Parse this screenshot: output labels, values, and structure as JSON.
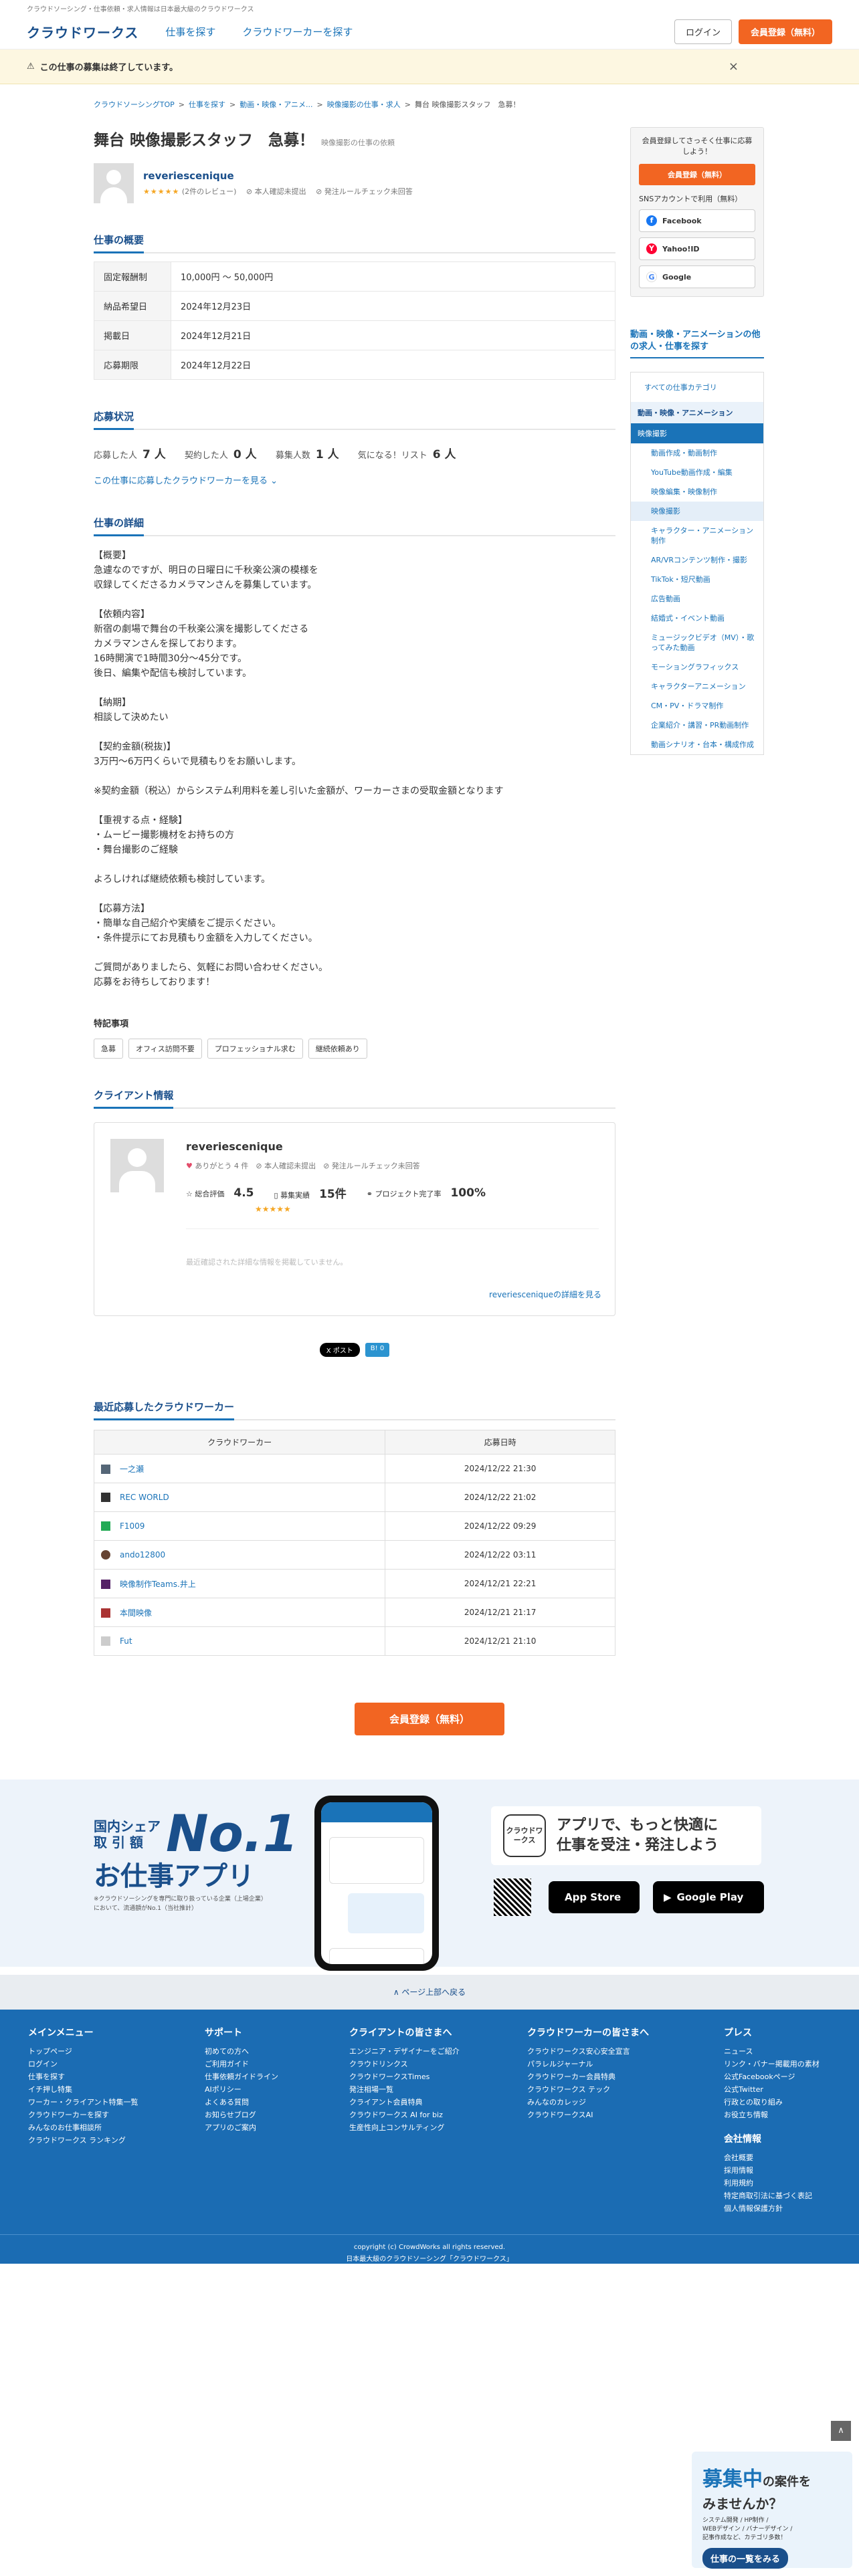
{
  "top_strip": "クラウドソーシング・仕事依頼・求人情報は日本最大級のクラウドワークス",
  "header": {
    "logo": "クラウドワークス",
    "nav": [
      "仕事を探す",
      "クラウドワーカーを探す"
    ],
    "login": "ログイン",
    "register": "会員登録（無料）"
  },
  "notice": {
    "text": "この仕事の募集は終了しています。",
    "close": "×"
  },
  "breadcrumb": [
    "クラウドソーシングTOP",
    "仕事を探す",
    "動画・映像・アニメ...",
    "映像撮影の仕事・求人",
    "舞台 映像撮影スタッフ　急募！"
  ],
  "job": {
    "title": "舞台 映像撮影スタッフ　急募！",
    "category": "映像撮影の仕事の依頼",
    "client_name": "reveriescenique",
    "stars": "★★★★★",
    "reviews": "(2件のレビュー)",
    "identity": "本人確認未提出",
    "rules": "発注ルールチェック未回答"
  },
  "overview": {
    "heading": "仕事の概要",
    "rows": [
      {
        "label": "固定報酬制",
        "value": "10,000円 〜 50,000円"
      },
      {
        "label": "納品希望日",
        "value": "2024年12月23日"
      },
      {
        "label": "掲載日",
        "value": "2024年12月21日"
      },
      {
        "label": "応募期限",
        "value": "2024年12月22日"
      }
    ]
  },
  "apply": {
    "heading": "応募状況",
    "stats": [
      {
        "label": "応募した人",
        "value": "7 人"
      },
      {
        "label": "契約した人",
        "value": "0 人"
      },
      {
        "label": "募集人数",
        "value": "1 人"
      },
      {
        "label": "気になる！リスト",
        "value": "6 人"
      }
    ],
    "link": "この仕事に応募したクラウドワーカーを見る"
  },
  "detail": {
    "heading": "仕事の詳細",
    "text": "【概要】\n急遽なのですが、明日の日曜日に千秋楽公演の模様を\n収録してくださるカメラマンさんを募集しています。\n\n【依頼内容】\n新宿の劇場で舞台の千秋楽公演を撮影してくださる\nカメラマンさんを探しております。\n16時開演で1時間30分〜45分です。\n後日、編集や配信も検討しています。\n\n【納期】\n相談して決めたい\n\n【契約金額(税抜)】\n3万円〜6万円くらいで見積もりをお願いします。\n\n※契約金額（税込）からシステム利用料を差し引いた金額が、ワーカーさまの受取金額となります\n\n【重視する点・経験】\n・ムービー撮影機材をお持ちの方\n・舞台撮影のご経験\n\nよろしければ継続依頼も検討しています。\n\n【応募方法】\n・簡単な自己紹介や実績をご提示ください。\n・条件提示にてお見積もり金額を入力してください。\n\nご質問がありましたら、気軽にお問い合わせください。\n応募をお待ちしております！"
  },
  "features": {
    "heading": "特記事項",
    "tags": [
      "急募",
      "オフィス訪問不要",
      "プロフェッショナル求む",
      "継続依頼あり"
    ]
  },
  "client": {
    "heading": "クライアント情報",
    "name": "reveriescenique",
    "thanks": "ありがとう 4 件",
    "identity": "本人確認未提出",
    "rules": "発注ルールチェック未回答",
    "rating_label": "総合評価",
    "rating": "4.5",
    "rating_stars": "★★★★★",
    "jobs_label": "募集実績",
    "jobs": "15件",
    "completion_label": "プロジェクト完了率",
    "completion": "100%",
    "note": "最近確認された詳細な情報を掲載していません。",
    "more": "reveriesceniqueの詳細を見る"
  },
  "share": {
    "x": "X ポスト",
    "hatena": "B! 0"
  },
  "workers": {
    "heading": "最近応募したクラウドワーカー",
    "col_worker": "クラウドワーカー",
    "col_date": "応募日時",
    "rows": [
      {
        "name": "一之瀬",
        "date": "2024/12/22 21:30"
      },
      {
        "name": "REC WORLD",
        "date": "2024/12/22 21:02"
      },
      {
        "name": "F1009",
        "date": "2024/12/22 09:29"
      },
      {
        "name": "ando12800",
        "date": "2024/12/22 03:11"
      },
      {
        "name": "映像制作Teams.井上",
        "date": "2024/12/21 22:21"
      },
      {
        "name": "本間映像",
        "date": "2024/12/21 21:17"
      },
      {
        "name": "Fut",
        "date": "2024/12/21 21:10"
      }
    ]
  },
  "cta": "会員登録（無料）",
  "side": {
    "reg_text": "会員登録してさっそく仕事に応募しよう！",
    "reg_btn": "会員登録（無料）",
    "sns_heading": "SNSアカウントで利用（無料）",
    "sns": [
      "Facebook",
      "Yahoo!ID",
      "Google"
    ],
    "cat_heading": "動画・映像・アニメーションの他の求人・仕事を探す",
    "all": "すべての仕事カテゴリ",
    "lvl1": "動画・映像・アニメーション",
    "lvl2": "映像撮影",
    "subs": [
      "動画作成・動画制作",
      "YouTube動画作成・編集",
      "映像編集・映像制作",
      "映像撮影",
      "キャラクター・アニメーション制作",
      "AR/VRコンテンツ制作・撮影",
      "TikTok・短尺動画",
      "広告動画",
      "結婚式・イベント動画",
      "ミュージックビデオ（MV）・歌ってみた動画",
      "モーショングラフィックス",
      "キャラクターアニメーション",
      "CM・PV・ドラマ制作",
      "企業紹介・講習・PR動画制作",
      "動画シナリオ・台本・構成作成"
    ]
  },
  "app": {
    "share": "国内シェア\n取 引 額",
    "no1": "No.1",
    "name": "お仕事アプリ",
    "note": "※クラウドソーシングを専門に取り扱っている企業（上場企業）において、流通額がNo.1（当社推計）",
    "brand": "クラウドワークス",
    "tagline": "アプリで、もっと快適に\n仕事を受注・発注しよう",
    "appstore": "App Store",
    "googleplay": "Google Play"
  },
  "totop": "∧ ページ上部へ戻る",
  "footer": {
    "cols": [
      {
        "h": "メインメニュー",
        "items": [
          "トップページ",
          "ログイン",
          "仕事を探す",
          "イチ押し特集",
          "ワーカー・クライアント特集一覧",
          "クラウドワーカーを探す",
          "みんなのお仕事相談所",
          "クラウドワークス ランキング"
        ]
      },
      {
        "h": "サポート",
        "items": [
          "初めての方へ",
          "ご利用ガイド",
          "仕事依頼ガイドライン",
          "AIポリシー",
          "よくある質問",
          "お知らせブログ",
          "アプリのご案内"
        ]
      },
      {
        "h": "クライアントの皆さまへ",
        "items": [
          "エンジニア・デザイナーをご紹介",
          "クラウドリンクス",
          "クラウドワークスTimes",
          "発注相場一覧",
          "クライアント会員特典",
          "クラウドワークス AI for biz",
          "生産性向上コンサルティング"
        ]
      },
      {
        "h": "クラウドワーカーの皆さまへ",
        "items": [
          "クラウドワークス安心安全宣言",
          "パラレルジャーナル",
          "クラウドワーカー会員特典",
          "クラウドワークス テック",
          "みんなのカレッジ",
          "クラウドワークスAI"
        ]
      },
      {
        "h": "プレス",
        "items": [
          "ニュース",
          "リンク・バナー掲載用の素材",
          "公式Facebookページ",
          "公式Twitter",
          "行政との取り組み",
          "お役立ち情報"
        ]
      }
    ],
    "company_h": "会社情報",
    "company": [
      "会社概要",
      "採用情報",
      "利用規約",
      "特定商取引法に基づく表記",
      "個人情報保護方針"
    ],
    "copyright": "copyright (c) CrowdWorks all rights reserved.",
    "tagline": "日本最大級のクラウドソーシング「クラウドワークス」"
  },
  "recruit": {
    "h": "募集中",
    "h_small": "の案件",
    "h_tail": "を",
    "h2": "みませんか？",
    "text": "システム開発 / HP制作 /\nWEBデザイン / バナーデザイン /\n記事作成など、カテゴリ多数！",
    "btn": "仕事の一覧をみる"
  }
}
